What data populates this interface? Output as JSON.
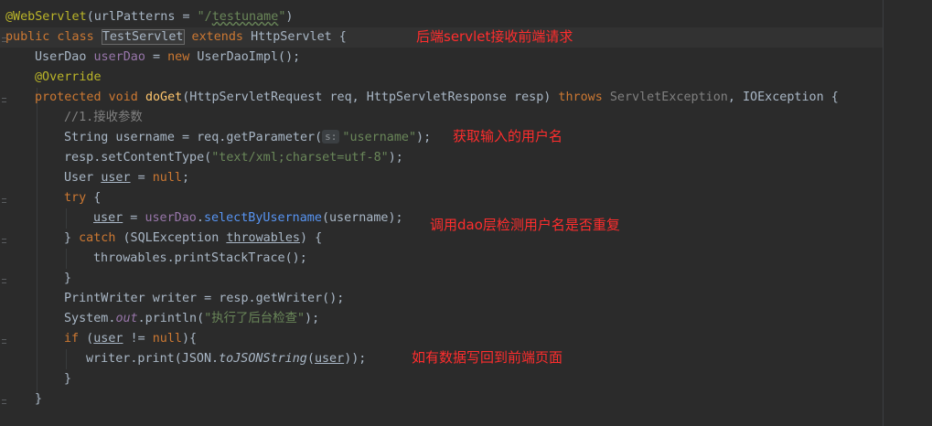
{
  "code": {
    "l1": {
      "ann": "@WebServlet",
      "p1": "(urlPatterns = ",
      "s1": "\"/",
      "s2": "testuname",
      "s3": "\"",
      "p2": ")"
    },
    "l2": {
      "kw1": "public class ",
      "cls": "TestServlet",
      "kw2": " extends ",
      "t1": "HttpServlet {"
    },
    "l3": {
      "t1": "UserDao ",
      "f1": "userDao",
      "t2": " = ",
      "kw": "new ",
      "t3": "UserDaoImpl();"
    },
    "l4": {
      "ann": "@Override"
    },
    "l5": {
      "kw1": "protected void ",
      "m": "doGet",
      "t1": "(HttpServletRequest req, HttpServletResponse resp) ",
      "kw2": "throws ",
      "g1": "ServletException",
      "t2": ", IOException {"
    },
    "l6": {
      "c": "//1.接收参数"
    },
    "l7": {
      "t1": "String username = req.getParameter(",
      "hint": "s:",
      "s": "\"username\"",
      "t2": ");"
    },
    "l8": {
      "t1": "resp.setContentType(",
      "s": "\"text/xml;charset=utf-8\"",
      "t2": ");"
    },
    "l9": {
      "t1": "User ",
      "u": "user",
      "t2": " = ",
      "n": "null",
      "t3": ";"
    },
    "l10": {
      "kw": "try",
      "t1": " {"
    },
    "l11": {
      "u": "user",
      "t1": " = ",
      "f": "userDao",
      "t2": ".",
      "m": "selectByUsername",
      "t3": "(username);"
    },
    "l12": {
      "t1": "} ",
      "kw": "catch",
      "t2": " (SQLException ",
      "u": "throwables",
      "t3": ") {"
    },
    "l13": {
      "t1": "throwables.printStackTrace();"
    },
    "l14": {
      "t1": "}"
    },
    "l15": {
      "t1": "PrintWriter writer = resp.getWriter();"
    },
    "l16": {
      "t1": "System.",
      "f": "out",
      "t2": ".println(",
      "s": "\"执行了后台检查\"",
      "t3": ");"
    },
    "l17": {
      "kw": "if",
      "t1": " (",
      "u": "user",
      "t2": " != ",
      "n": "null",
      "t3": "){"
    },
    "l18": {
      "t1": "writer.print(JSON.",
      "m": "toJSONString",
      "t2": "(",
      "u": "user",
      "t3": "));"
    },
    "l19": {
      "t1": "}"
    },
    "l20": {
      "t1": "}"
    }
  },
  "notes": {
    "n1": "后端servlet接收前端请求",
    "n2": "获取输入的用户名",
    "n3": "调用dao层检测用户名是否重复",
    "n4": "如有数据写回到前端页面"
  },
  "colors": {
    "background": "#2b2b2b",
    "keyword": "#cc7832",
    "annotation": "#bbb529",
    "string": "#6a8759",
    "field": "#9876aa",
    "method": "#ffc66d",
    "comment": "#808080",
    "note": "#ff2d2d"
  }
}
